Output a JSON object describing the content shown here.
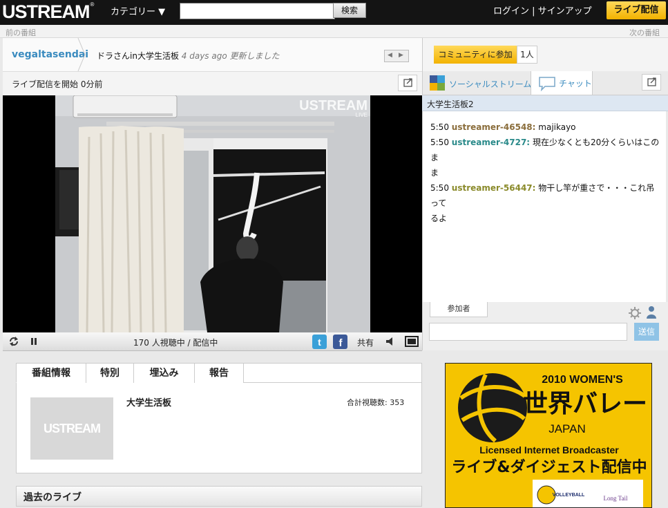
{
  "topbar": {
    "logo": "USTREAM",
    "logo_mark": "®",
    "category": "カテゴリー",
    "category_arrow": "▼",
    "search_button": "検索",
    "search_value": "",
    "login_signup": "ログイン | サインアップ",
    "go_live": "ライブ配信"
  },
  "nav": {
    "prev": "前の番組",
    "next": "次の番組"
  },
  "show": {
    "channel": "vegaltasendai",
    "title": "ドラさんin大学生活板",
    "time_ago": "4 days ago",
    "updated": "更新しました",
    "live_status": "ライブ配信を開始 0分前"
  },
  "video": {
    "watermark": "USTREAM",
    "watermark_sub": "LIVE"
  },
  "controls": {
    "viewers": "170 人視聴中 / 配信中",
    "share": "共有"
  },
  "community": {
    "join_button": "コミュニティに参加",
    "member_count": "1人"
  },
  "right_tabs": {
    "social": "ソーシャルストリーム",
    "chat": "チャット"
  },
  "chat": {
    "room": "大学生活板2",
    "messages": [
      {
        "time": "5:50",
        "user": "ustreamer-46548:",
        "text": "majikayo",
        "color": "#8a6d3b"
      },
      {
        "time": "5:50",
        "user": "ustreamer-4727:",
        "text": "現在少なくとも20分くらいはこのま",
        "text2": "ま",
        "color": "#2a8a8a"
      },
      {
        "time": "5:50",
        "user": "ustreamer-56447:",
        "text": "物干し竿が重さで・・・これ吊って",
        "text2": "るよ",
        "color": "#8a8a2a"
      }
    ],
    "participants_tab": "参加者",
    "send_button": "送信",
    "input_value": ""
  },
  "info": {
    "tabs": [
      "番組情報",
      "特別",
      "埋込み",
      "報告"
    ],
    "program_name": "大学生活板",
    "total_views": "合計視聴数: 353",
    "thumb_text": "USTREAM",
    "past_live": "過去のライブ"
  },
  "ad": {
    "line1": "2010 WOMEN'S",
    "line2": "世界バレー",
    "line3": "JAPAN",
    "line4": "Licensed Internet Broadcaster",
    "line5": "ライブ&ダイジェスト配信中",
    "logo_text": "VOLLEYBALL",
    "logo_text2": "Long Tail"
  },
  "colors": {
    "accent_yellow": "#f2b200",
    "link_blue": "#3a8bbf",
    "topbar": "#141414"
  }
}
